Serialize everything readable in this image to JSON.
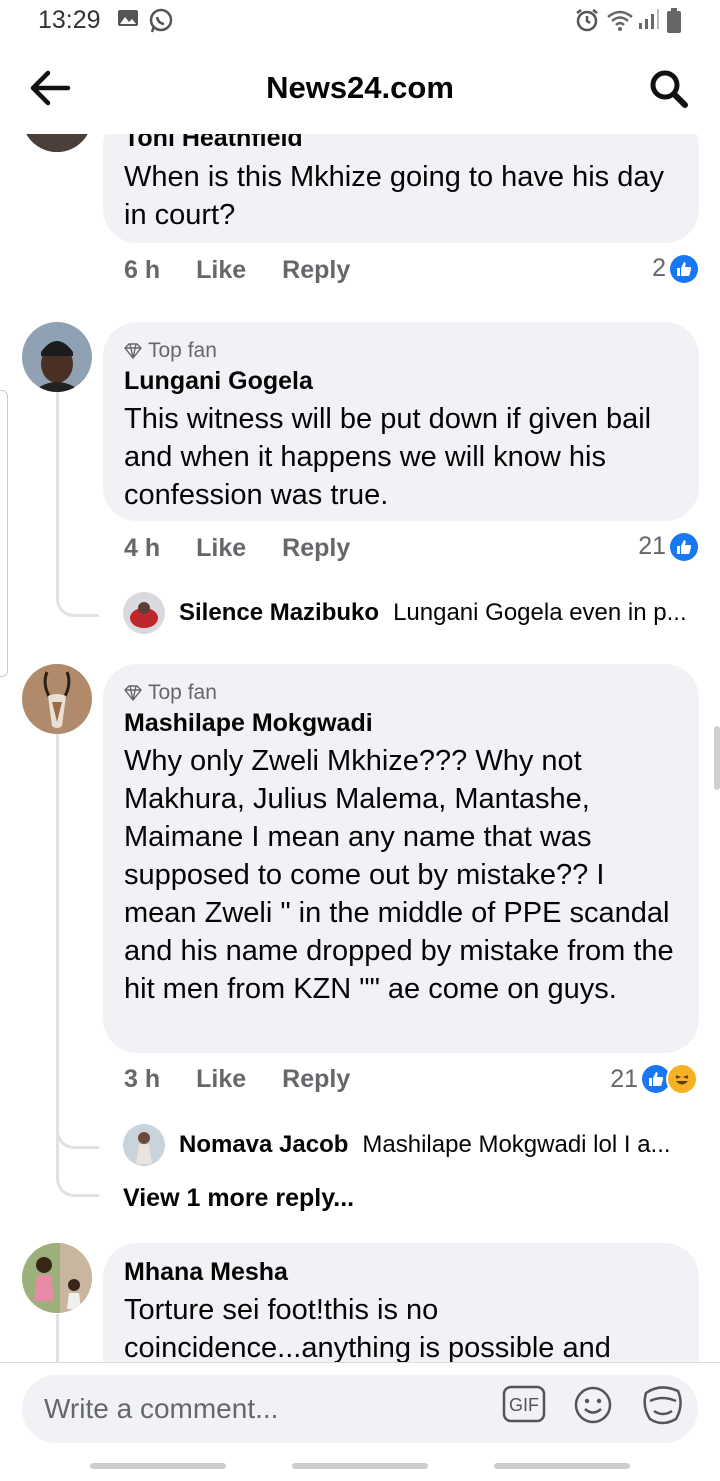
{
  "status": {
    "time": "13:29"
  },
  "header": {
    "title": "News24.com"
  },
  "comments": [
    {
      "author": "Toni Heathfield",
      "text": "When is this Mkhize going  to have his day in court?",
      "time": "6 h",
      "like_label": "Like",
      "reply_label": "Reply",
      "reaction_count": "2"
    },
    {
      "badge": "Top fan",
      "author": "Lungani Gogela",
      "text": "This witness will be put down if given bail and when it happens we will know his confession was true.",
      "time": "4 h",
      "like_label": "Like",
      "reply_label": "Reply",
      "reaction_count": "21",
      "reply": {
        "author": "Silence Mazibuko",
        "text": "Lungani Gogela even in p..."
      }
    },
    {
      "badge": "Top fan",
      "author": "Mashilape Mokgwadi",
      "text": "Why only Zweli Mkhize??? Why not Makhura, Julius Malema, Mantashe, Maimane I mean any name that was supposed to come out by mistake?? I mean Zweli \" in the middle of PPE scandal and his name dropped by mistake from the hit men from KZN \"\" ae come on guys.",
      "time": "3 h",
      "like_label": "Like",
      "reply_label": "Reply",
      "reaction_count": "21",
      "reply": {
        "author": "Nomava Jacob",
        "text": "Mashilape Mokgwadi lol I a..."
      },
      "more_replies": "View 1 more reply..."
    },
    {
      "author": "Mhana Mesha",
      "text": "Torture sei foot!this is no coincidence...anything is possible and"
    }
  ],
  "composer": {
    "placeholder": "Write a comment...",
    "gif_label": "GIF"
  },
  "colors": {
    "accent": "#1877f2",
    "bubble": "#f0f2f5",
    "muted": "#65676b"
  }
}
